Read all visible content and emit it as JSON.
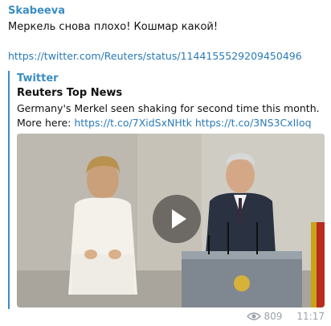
{
  "message": {
    "sender": "Skabeeva",
    "text": "Меркель снова плохо! Кошмар какой!",
    "link": "https://twitter.com/Reuters/status/1144155529209450496"
  },
  "preview": {
    "site": "Twitter",
    "title": "Reuters Top News",
    "description": "Germany's Merkel seen shaking for second time this month.",
    "more_here": "More here:",
    "link1": "https://t.co/7XidSxNHtk",
    "link2": "https://t.co/3NS3CxIIoq"
  },
  "video": {
    "play_icon": "play-icon"
  },
  "footer": {
    "views": "809",
    "time": "11:17",
    "eye_icon": "eye-icon"
  },
  "colors": {
    "accent": "#3a8dc5",
    "link": "#2a7ab8",
    "meta": "#9aa3ab"
  }
}
